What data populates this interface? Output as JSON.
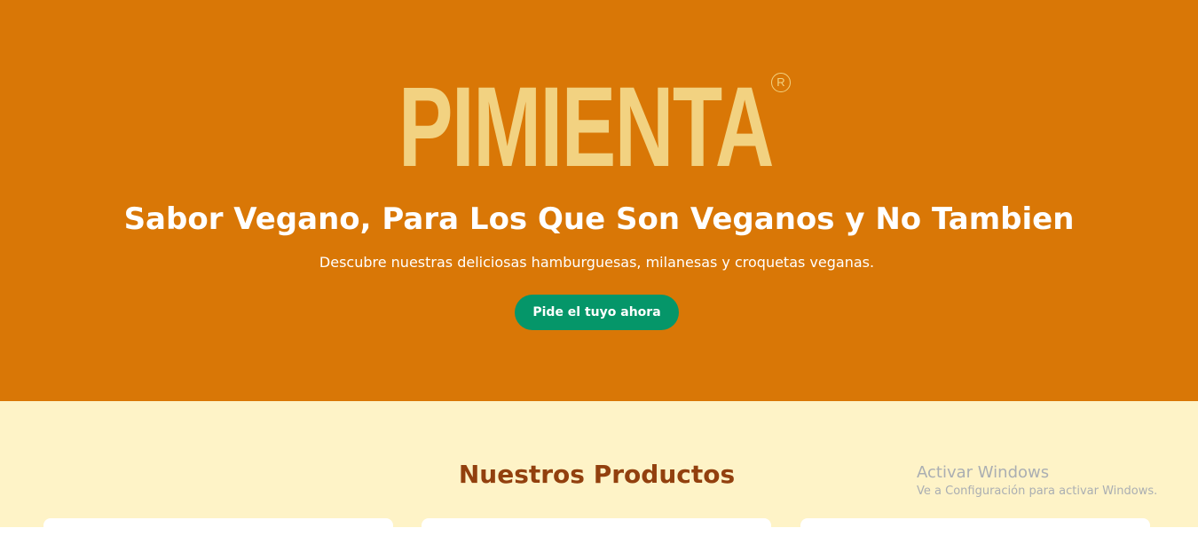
{
  "hero": {
    "logo_text": "PIMIENTA",
    "registered_mark": "R",
    "title": "Sabor Vegano, Para Los Que Son Veganos y No Tambien",
    "subtitle": "Descubre nuestras deliciosas hamburguesas, milanesas y croquetas veganas.",
    "cta_label": "Pide el tuyo ahora"
  },
  "products": {
    "title": "Nuestros Productos",
    "cards": [
      {},
      {},
      {}
    ]
  },
  "os_watermark": {
    "title": "Activar Windows",
    "subtitle": "Ve a Configuración para activar Windows."
  },
  "colors": {
    "hero_bg": "#d97706",
    "logo": "#f2d281",
    "cta_bg": "#059669",
    "products_bg": "#fef3c7",
    "products_title": "#92400e"
  }
}
